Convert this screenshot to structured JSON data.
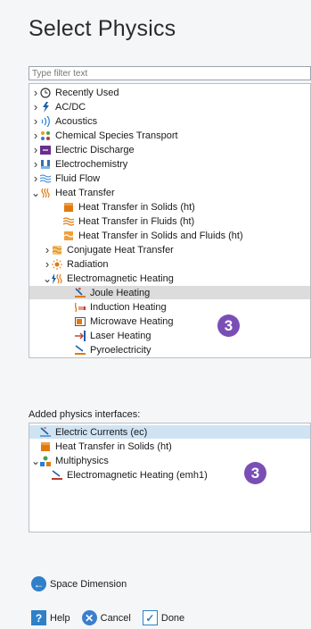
{
  "title": "Select Physics",
  "filter": {
    "placeholder": "Type filter text"
  },
  "tree": [
    {
      "label": "Recently Used",
      "icon": "clock-icon",
      "indent": 0,
      "chevron": ">"
    },
    {
      "label": "AC/DC",
      "icon": "acdc-icon",
      "indent": 0,
      "chevron": ">"
    },
    {
      "label": "Acoustics",
      "icon": "acoustics-icon",
      "indent": 0,
      "chevron": ">"
    },
    {
      "label": "Chemical Species Transport",
      "icon": "chemical-species-icon",
      "indent": 0,
      "chevron": ">"
    },
    {
      "label": "Electric Discharge",
      "icon": "electric-discharge-icon",
      "indent": 0,
      "chevron": ">"
    },
    {
      "label": "Electrochemistry",
      "icon": "electrochemistry-icon",
      "indent": 0,
      "chevron": ">"
    },
    {
      "label": "Fluid Flow",
      "icon": "fluid-flow-icon",
      "indent": 0,
      "chevron": ">"
    },
    {
      "label": "Heat Transfer",
      "icon": "heat-transfer-icon",
      "indent": 0,
      "chevron": "v"
    },
    {
      "label": "Heat Transfer in Solids (ht)",
      "icon": "heat-solids-icon",
      "indent": 2,
      "chevron": ""
    },
    {
      "label": "Heat Transfer in Fluids (ht)",
      "icon": "heat-fluids-icon",
      "indent": 2,
      "chevron": ""
    },
    {
      "label": "Heat Transfer in Solids and Fluids (ht)",
      "icon": "heat-solids-fluids-icon",
      "indent": 2,
      "chevron": ""
    },
    {
      "label": "Conjugate Heat Transfer",
      "icon": "conjugate-heat-icon",
      "indent": 1,
      "chevron": ">"
    },
    {
      "label": "Radiation",
      "icon": "radiation-icon",
      "indent": 1,
      "chevron": ">"
    },
    {
      "label": "Electromagnetic Heating",
      "icon": "em-heating-icon",
      "indent": 1,
      "chevron": "v"
    },
    {
      "label": "Joule Heating",
      "icon": "joule-heating-icon",
      "indent": 3,
      "chevron": "",
      "selected": true
    },
    {
      "label": "Induction Heating",
      "icon": "induction-heating-icon",
      "indent": 3,
      "chevron": ""
    },
    {
      "label": "Microwave Heating",
      "icon": "microwave-heating-icon",
      "indent": 3,
      "chevron": ""
    },
    {
      "label": "Laser Heating",
      "icon": "laser-heating-icon",
      "indent": 3,
      "chevron": ""
    },
    {
      "label": "Pyroelectricity",
      "icon": "pyroelectricity-icon",
      "indent": 3,
      "chevron": ""
    }
  ],
  "badge_value": "3",
  "added_title": "Added physics interfaces:",
  "added": [
    {
      "label": "Electric Currents (ec)",
      "icon": "electric-currents-icon",
      "indent": 0,
      "chevron": "",
      "selected": true
    },
    {
      "label": "Heat Transfer in Solids (ht)",
      "icon": "heat-solids-icon",
      "indent": 0,
      "chevron": ""
    },
    {
      "label": "Multiphysics",
      "icon": "multiphysics-icon",
      "indent": 0,
      "chevron": "v"
    },
    {
      "label": "Electromagnetic Heating (emh1)",
      "icon": "em-heating-coupling-icon",
      "indent": 1,
      "chevron": ""
    }
  ],
  "space_dimension": "Space Dimension",
  "buttons": {
    "help": "Help",
    "cancel": "Cancel",
    "done": "Done"
  },
  "colors": {
    "badge": "#7a4fb5",
    "selection_gray": "#dcdcdc",
    "selection_blue": "#cfe3f3",
    "accent_blue": "#2f80c9"
  }
}
